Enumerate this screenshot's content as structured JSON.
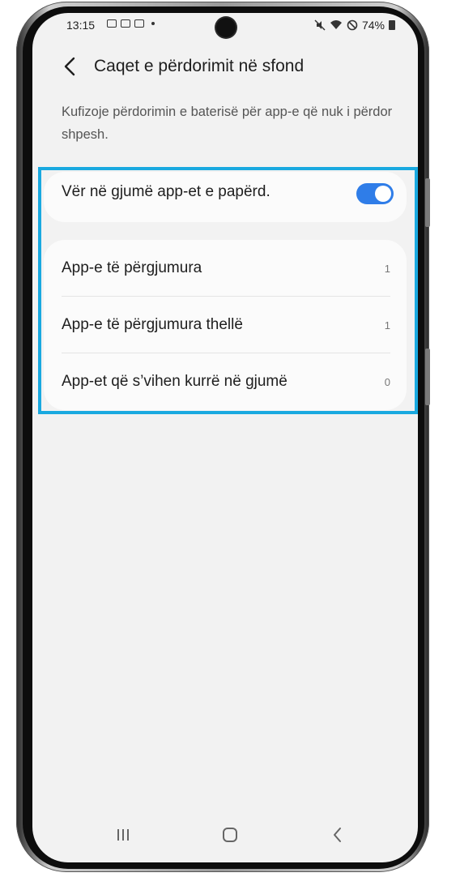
{
  "status_bar": {
    "time": "13:15",
    "battery": "74%",
    "left_icons": [
      "image-icon",
      "mail-icon",
      "message-icon",
      "notification-dot-icon"
    ],
    "right_icons": [
      "mute-icon",
      "wifi-icon",
      "dnd-icon",
      "battery-icon"
    ]
  },
  "header": {
    "title": "Caqet e përdorimit në sfond",
    "back_icon": "chevron-left-icon"
  },
  "description": "Kufizoje përdorimin e baterisë për app-e që nuk i përdor shpesh.",
  "toggle": {
    "label": "Vër në gjumë app-et e papërd.",
    "enabled": true,
    "color": "#2f7de8"
  },
  "list": [
    {
      "label": "App-e të përgjumura",
      "count": "1"
    },
    {
      "label": "App-e të përgjumura thellë",
      "count": "1"
    },
    {
      "label": "App-et që s’vihen kurrë në gjumë",
      "count": "0"
    }
  ],
  "highlight_color": "#19a9e0",
  "navbar": {
    "icons": [
      "recent-apps-icon",
      "home-icon",
      "back-icon"
    ]
  }
}
